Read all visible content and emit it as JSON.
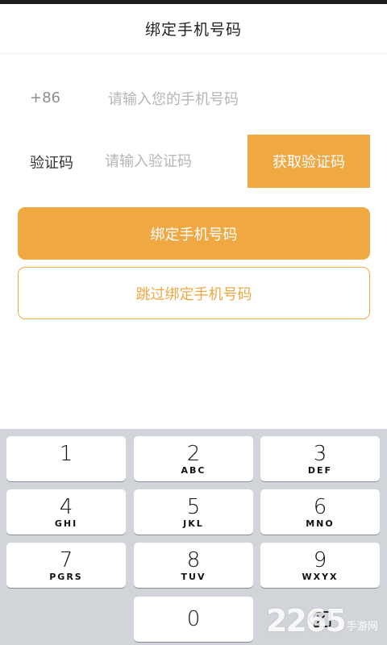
{
  "header": {
    "title": "绑定手机号码"
  },
  "phone": {
    "country_code": "+86",
    "placeholder": "请输入您的手机号码",
    "value": ""
  },
  "verification": {
    "label": "验证码",
    "placeholder": "请输入验证码",
    "value": "",
    "get_code_label": "获取验证码"
  },
  "actions": {
    "bind_label": "绑定手机号码",
    "skip_label": "跳过绑定手机号码"
  },
  "keyboard": {
    "keys": [
      {
        "num": "1",
        "letters": ""
      },
      {
        "num": "2",
        "letters": "ABC"
      },
      {
        "num": "3",
        "letters": "DEF"
      },
      {
        "num": "4",
        "letters": "GHI"
      },
      {
        "num": "5",
        "letters": "JKL"
      },
      {
        "num": "6",
        "letters": "MNO"
      },
      {
        "num": "7",
        "letters": "PGRS"
      },
      {
        "num": "8",
        "letters": "TUV"
      },
      {
        "num": "9",
        "letters": "WXYX"
      },
      {
        "num": "0",
        "letters": ""
      }
    ],
    "backspace_icon": "backspace-icon"
  },
  "watermark": {
    "number": "2265",
    "text": "手游网"
  },
  "colors": {
    "accent": "#f0a842",
    "keyboard_bg": "#d1d4d9"
  }
}
